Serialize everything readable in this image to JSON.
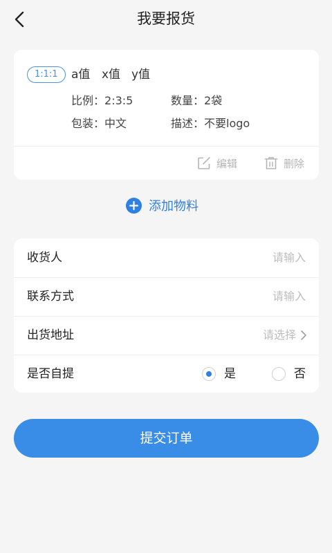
{
  "header": {
    "title": "我要报货"
  },
  "item": {
    "ratio_tag": "1:1:1",
    "specs": [
      "a值",
      "x值",
      "y值"
    ],
    "ratio": {
      "label": "比例：",
      "value": "2:3:5"
    },
    "quantity": {
      "label": "数量：",
      "value": "2袋"
    },
    "packaging": {
      "label": "包装：",
      "value": "中文"
    },
    "description": {
      "label": "描述：",
      "value": "不要logo"
    },
    "edit_label": "编辑",
    "delete_label": "删除"
  },
  "add_material": {
    "label": "添加物料"
  },
  "form": {
    "receiver": {
      "label": "收货人",
      "placeholder": "请输入"
    },
    "contact": {
      "label": "联系方式",
      "placeholder": "请输入"
    },
    "address": {
      "label": "出货地址",
      "placeholder": "请选择"
    },
    "self_pickup": {
      "label": "是否自提",
      "yes": "是",
      "no": "否",
      "selected": "是"
    }
  },
  "submit": {
    "label": "提交订单"
  },
  "colors": {
    "accent": "#3a8de6",
    "background": "#f5f5f6",
    "card": "#ffffff"
  }
}
